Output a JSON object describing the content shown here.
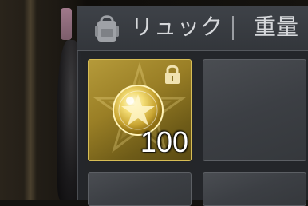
{
  "inventory": {
    "title": "リュック",
    "weight_label": "重量",
    "icons": {
      "bag": "backpack-icon",
      "lock": "lock-icon",
      "coin": "gold-coin-icon"
    },
    "slots": [
      {
        "item": "coin",
        "count": "100",
        "locked": true,
        "rarity_color": "#b59a3a"
      },
      {
        "item": null
      },
      {
        "item": null
      },
      {
        "item": null
      }
    ]
  }
}
